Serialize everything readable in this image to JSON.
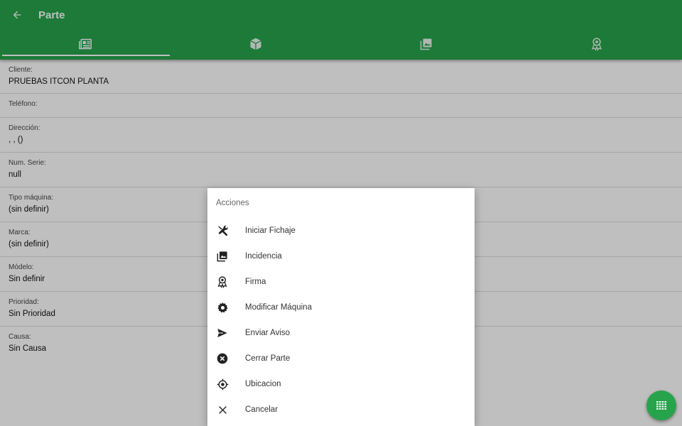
{
  "appbar": {
    "title": "Parte",
    "tabs": [
      {
        "icon": "document-list-icon",
        "active": true
      },
      {
        "icon": "package-box-icon",
        "active": false
      },
      {
        "icon": "photo-gallery-icon",
        "active": false
      },
      {
        "icon": "award-badge-icon",
        "active": false
      }
    ]
  },
  "fields": [
    {
      "label": "Cliente:",
      "value": "PRUEBAS ITCON PLANTA"
    },
    {
      "label": "Teléfono:",
      "value": ""
    },
    {
      "label": "Dirección:",
      "value": ", , ()"
    },
    {
      "label": "Num. Serie:",
      "value": "null"
    },
    {
      "label": "Tipo máquina:",
      "value": "(sin definir)"
    },
    {
      "label": "Marca:",
      "value": "(sin definir)"
    },
    {
      "label": "Módelo:",
      "value": "Sin definir"
    },
    {
      "label": "Prioridad:",
      "value": "Sin Prioridad"
    },
    {
      "label": "Causa:",
      "value": "Sin Causa"
    }
  ],
  "dialog": {
    "title": "Acciones",
    "actions": [
      {
        "label": "Iniciar Fichaje",
        "icon": "tools-icon"
      },
      {
        "label": "Incidencia",
        "icon": "photo-gallery-icon"
      },
      {
        "label": "Firma",
        "icon": "award-badge-icon"
      },
      {
        "label": "Modificar Máquina",
        "icon": "settings-gear-icon"
      },
      {
        "label": "Enviar Aviso",
        "icon": "send-icon"
      },
      {
        "label": "Cerrar Parte",
        "icon": "close-circle-icon"
      },
      {
        "label": "Ubicacion",
        "icon": "location-crosshair-icon"
      },
      {
        "label": "Cancelar",
        "icon": "close-icon"
      }
    ]
  },
  "fab": {
    "icon": "keypad-grid-icon"
  },
  "colors": {
    "primary": "#27a34b",
    "scrim": "rgba(0,0,0,0.25)"
  }
}
